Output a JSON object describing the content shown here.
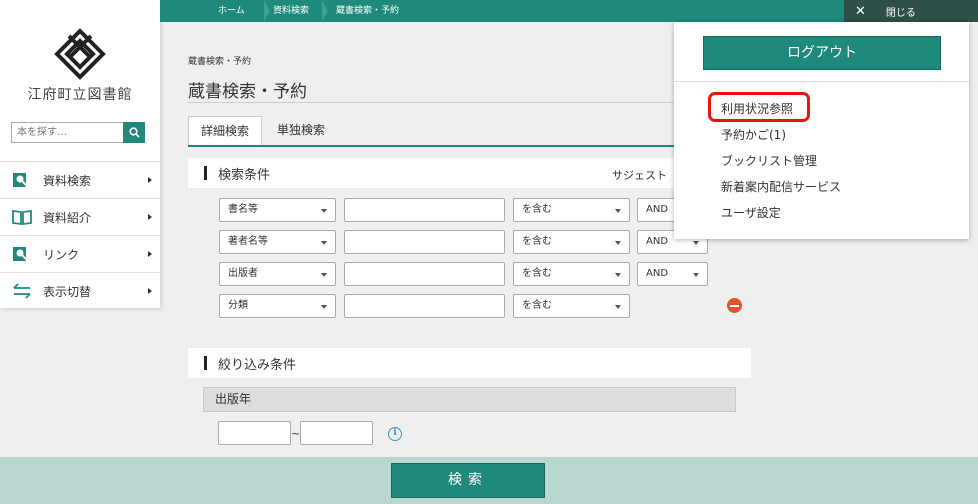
{
  "breadcrumb": [
    "ホーム",
    "資料検索",
    "蔵書検索・予約"
  ],
  "close_label": "閉じる",
  "sidebar": {
    "library_name": "江府町立図書館",
    "search_placeholder": "本を探す…",
    "items": [
      {
        "label": "資料検索",
        "icon": "search-book-icon"
      },
      {
        "label": "資料紹介",
        "icon": "open-book-icon"
      },
      {
        "label": "リンク",
        "icon": "link-search-icon"
      },
      {
        "label": "表示切替",
        "icon": "switch-arrows-icon"
      }
    ]
  },
  "main": {
    "small_title": "蔵書検索・予約",
    "page_title": "蔵書検索・予約",
    "tabs": [
      "詳細検索",
      "単独検索"
    ],
    "conditions_title": "検索条件",
    "suggest_label": "サジェスト",
    "rows": [
      {
        "field": "書名等",
        "match": "を含む",
        "op": "AND"
      },
      {
        "field": "著者名等",
        "match": "を含む",
        "op": "AND"
      },
      {
        "field": "出版者",
        "match": "を含む",
        "op": "AND"
      },
      {
        "field": "分類",
        "match": "を含む",
        "op": ""
      }
    ],
    "filter_title": "絞り込み条件",
    "pub_year_label": "出版年",
    "tilde": "~",
    "info_label": "i"
  },
  "search_button": "検索",
  "account_menu": {
    "logout_label": "ログアウト",
    "items": [
      "利用状況参照",
      "予約かご(1)",
      "ブックリスト管理",
      "新着案内配信サービス",
      "ユーザ設定"
    ]
  },
  "colors": {
    "accent": "#1f8a7c",
    "highlight": "#e8140e",
    "remove": "#e0552d"
  }
}
